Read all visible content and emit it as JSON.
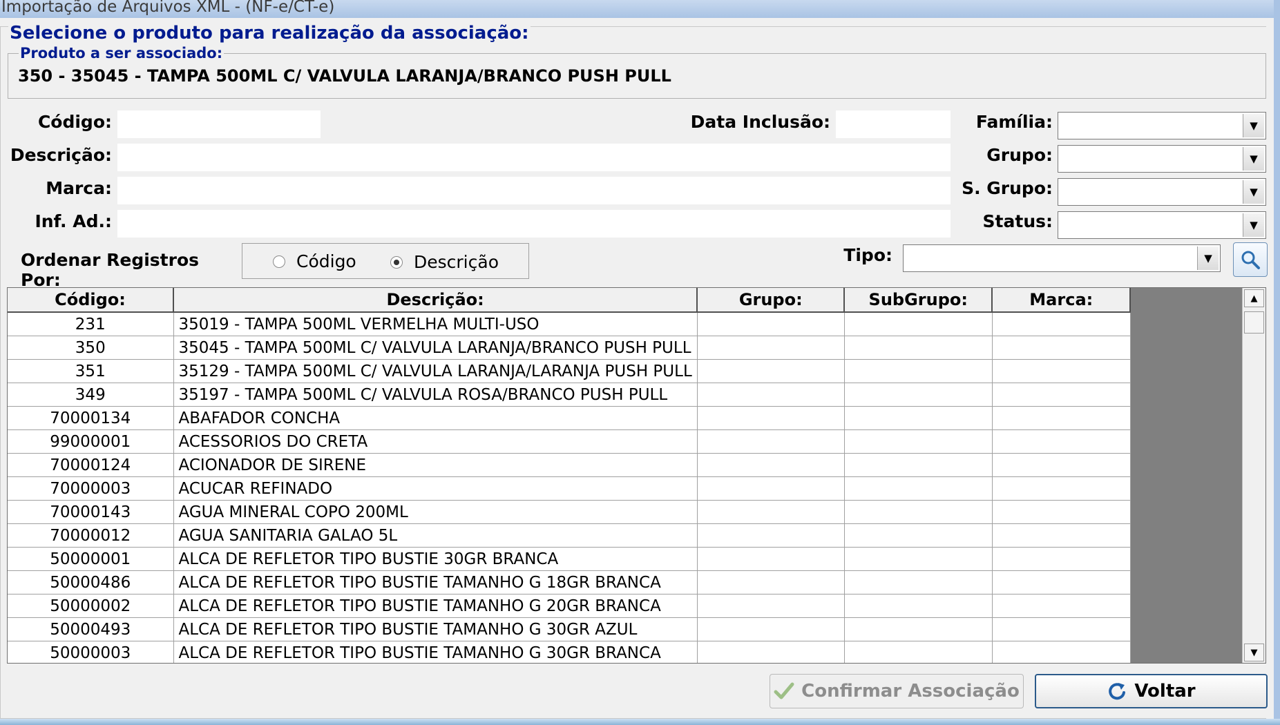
{
  "window": {
    "title": "Importação de Arquivos XML - (NF-e/CT-e)"
  },
  "group": {
    "legend": "Selecione o produto para realização da associação:"
  },
  "product": {
    "legend": "Produto a ser associado:",
    "value": "350 - 35045 - TAMPA 500ML C/ VALVULA LARANJA/BRANCO PUSH PULL"
  },
  "filters": {
    "codigo_label": "Código:",
    "data_inclusao_label": "Data Inclusão:",
    "descricao_label": "Descrição:",
    "marca_label": "Marca:",
    "inf_ad_label": "Inf. Ad.:",
    "familia_label": "Família:",
    "grupo_label": "Grupo:",
    "s_grupo_label": "S. Grupo:",
    "status_label": "Status:",
    "tipo_label": "Tipo:",
    "codigo_value": "",
    "data_inclusao_value": "",
    "descricao_value": "",
    "marca_value": "",
    "inf_ad_value": "",
    "familia_value": "",
    "grupo_value": "",
    "s_grupo_value": "",
    "status_value": "",
    "tipo_value": ""
  },
  "order": {
    "label": "Ordenar Registros Por:",
    "option_codigo": "Código",
    "option_descricao": "Descrição",
    "selected": "Descrição"
  },
  "table": {
    "headers": [
      "Código:",
      "Descrição:",
      "Grupo:",
      "SubGrupo:",
      "Marca:"
    ],
    "rows": [
      [
        "231",
        "35019 - TAMPA 500ML VERMELHA MULTI-USO",
        "",
        "",
        ""
      ],
      [
        "350",
        "35045 - TAMPA 500ML C/ VALVULA LARANJA/BRANCO PUSH PULL",
        "",
        "",
        ""
      ],
      [
        "351",
        "35129 - TAMPA 500ML C/ VALVULA LARANJA/LARANJA PUSH PULL",
        "",
        "",
        ""
      ],
      [
        "349",
        "35197 - TAMPA 500ML C/ VALVULA ROSA/BRANCO PUSH PULL",
        "",
        "",
        ""
      ],
      [
        "70000134",
        "ABAFADOR CONCHA",
        "",
        "",
        ""
      ],
      [
        "99000001",
        "ACESSORIOS DO CRETA",
        "",
        "",
        ""
      ],
      [
        "70000124",
        "ACIONADOR DE SIRENE",
        "",
        "",
        ""
      ],
      [
        "70000003",
        "ACUCAR REFINADO",
        "",
        "",
        ""
      ],
      [
        "70000143",
        "AGUA MINERAL COPO 200ML",
        "",
        "",
        ""
      ],
      [
        "70000012",
        "AGUA SANITARIA GALAO 5L",
        "",
        "",
        ""
      ],
      [
        "50000001",
        "ALCA DE REFLETOR TIPO BUSTIE 30GR BRANCA",
        "",
        "",
        ""
      ],
      [
        "50000486",
        "ALCA DE REFLETOR TIPO BUSTIE TAMANHO G 18GR BRANCA",
        "",
        "",
        ""
      ],
      [
        "50000002",
        "ALCA DE REFLETOR TIPO BUSTIE TAMANHO G 20GR BRANCA",
        "",
        "",
        ""
      ],
      [
        "50000493",
        "ALCA DE REFLETOR TIPO BUSTIE TAMANHO G 30GR AZUL",
        "",
        "",
        ""
      ],
      [
        "50000003",
        "ALCA DE REFLETOR TIPO BUSTIE TAMANHO G 30GR BRANCA",
        "",
        "",
        ""
      ]
    ]
  },
  "buttons": {
    "confirm_label": "Confirmar Associação",
    "back_label": "Voltar"
  },
  "icons": {
    "search": "magnifier-icon",
    "confirm": "check-icon",
    "back": "refresh-arrow-icon"
  }
}
